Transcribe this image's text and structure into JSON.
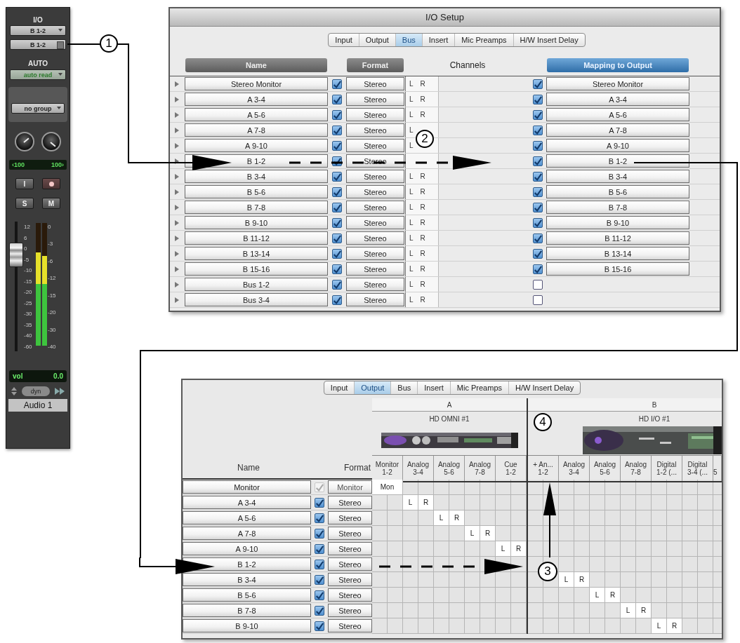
{
  "strip": {
    "io_label": "I/O",
    "input": "B 1-2",
    "output": "B 1-2",
    "auto_label": "AUTO",
    "automation": "auto read",
    "group": "no group",
    "pan": [
      "‹100",
      "100›"
    ],
    "buttons": [
      {
        "kind": "input",
        "label": "I"
      },
      {
        "kind": "record"
      },
      {
        "kind": "solo",
        "label": "S"
      },
      {
        "kind": "mute",
        "label": "M"
      }
    ],
    "fader": {
      "level": 0.8,
      "scale": [
        "12",
        "6",
        "0",
        "-5",
        "-10",
        "-15",
        "-20",
        "-25",
        "-30",
        "-35",
        "-40",
        "-60"
      ]
    },
    "meters": [
      {
        "level": 0.76
      },
      {
        "level": 0.73
      }
    ],
    "meter_scale": [
      "0",
      "-3",
      "-6",
      "-12",
      "-15",
      "-20",
      "-30",
      "-40"
    ],
    "volume": {
      "label": "vol",
      "value": "0.0"
    },
    "dyn": "dyn",
    "name": "Audio 1"
  },
  "io_setup": {
    "title": "I/O Setup",
    "tabs": [
      {
        "label": "Input",
        "selected": false
      },
      {
        "label": "Output",
        "selected": false
      },
      {
        "label": "Bus",
        "selected": true
      },
      {
        "label": "Insert",
        "selected": false
      },
      {
        "label": "Mic Preamps",
        "selected": false
      },
      {
        "label": "H/W Insert Delay",
        "selected": false
      }
    ],
    "headers": [
      {
        "kind": "button",
        "label": "Name",
        "selected": false
      },
      {
        "kind": "button",
        "label": "Format",
        "selected": false
      },
      {
        "kind": "label",
        "label": "Channels"
      },
      {
        "kind": "button",
        "label": "Mapping to Output",
        "selected": true
      }
    ],
    "rows": [
      {
        "name": "Stereo Monitor",
        "checked": true,
        "format": "Stereo",
        "channels": [
          "L",
          "R"
        ],
        "mapped": true,
        "mapping": "Stereo Monitor"
      },
      {
        "name": "A 3-4",
        "checked": true,
        "format": "Stereo",
        "channels": [
          "L",
          "R"
        ],
        "mapped": true,
        "mapping": "A 3-4"
      },
      {
        "name": "A 5-6",
        "checked": true,
        "format": "Stereo",
        "channels": [
          "L",
          "R"
        ],
        "mapped": true,
        "mapping": "A 5-6"
      },
      {
        "name": "A 7-8",
        "checked": true,
        "format": "Stereo",
        "channels": [
          "L"
        ],
        "mapped": true,
        "mapping": "A 7-8"
      },
      {
        "name": "A 9-10",
        "checked": true,
        "format": "Stereo",
        "channels": [
          "L"
        ],
        "mapped": true,
        "mapping": "A 9-10"
      },
      {
        "name": "B 1-2",
        "checked": true,
        "format": "Stereo",
        "mapped": true,
        "mapping": "B 1-2"
      },
      {
        "name": "B 3-4",
        "checked": true,
        "format": "Stereo",
        "channels": [
          "L",
          "R"
        ],
        "mapped": true,
        "mapping": "B 3-4"
      },
      {
        "name": "B 5-6",
        "checked": true,
        "format": "Stereo",
        "channels": [
          "L",
          "R"
        ],
        "mapped": true,
        "mapping": "B 5-6"
      },
      {
        "name": "B 7-8",
        "checked": true,
        "format": "Stereo",
        "channels": [
          "L",
          "R"
        ],
        "mapped": true,
        "mapping": "B 7-8"
      },
      {
        "name": "B 9-10",
        "checked": true,
        "format": "Stereo",
        "channels": [
          "L",
          "R"
        ],
        "mapped": true,
        "mapping": "B 9-10"
      },
      {
        "name": "B 11-12",
        "checked": true,
        "format": "Stereo",
        "channels": [
          "L",
          "R"
        ],
        "mapped": true,
        "mapping": "B 11-12"
      },
      {
        "name": "B 13-14",
        "checked": true,
        "format": "Stereo",
        "channels": [
          "L",
          "R"
        ],
        "mapped": true,
        "mapping": "B 13-14"
      },
      {
        "name": "B 15-16",
        "checked": true,
        "format": "Stereo",
        "channels": [
          "L",
          "R"
        ],
        "mapped": true,
        "mapping": "B 15-16"
      },
      {
        "name": "Bus 1-2",
        "checked": true,
        "format": "Stereo",
        "channels": [
          "L",
          "R"
        ],
        "mapped": false
      },
      {
        "name": "Bus 3-4",
        "checked": true,
        "format": "Stereo",
        "channels": [
          "L",
          "R"
        ],
        "mapped": false
      }
    ]
  },
  "output_setup": {
    "tabs": [
      {
        "label": "Input",
        "selected": false
      },
      {
        "label": "Output",
        "selected": true
      },
      {
        "label": "Bus",
        "selected": false
      },
      {
        "label": "Insert",
        "selected": false
      },
      {
        "label": "Mic Preamps",
        "selected": false
      },
      {
        "label": "H/W Insert Delay",
        "selected": false
      }
    ],
    "headers": {
      "name": "Name",
      "format": "Format"
    },
    "groups": [
      {
        "label": "A",
        "device": "HD OMNI #1",
        "image": {
          "kind": "picture"
        },
        "columns": [
          {
            "line1": "Monitor",
            "line2": "1-2"
          },
          {
            "line1": "Analog",
            "line2": "3-4"
          },
          {
            "line1": "Analog",
            "line2": "5-6"
          },
          {
            "line1": "Analog",
            "line2": "7-8"
          },
          {
            "line1": "Cue",
            "line2": "1-2"
          }
        ]
      },
      {
        "label": "B",
        "device": "HD I/O #1",
        "image": {
          "kind": "picture"
        },
        "columns": [
          {
            "line1": "+ An...",
            "line2": "1-2"
          },
          {
            "line1": "Analog",
            "line2": "3-4"
          },
          {
            "line1": "Analog",
            "line2": "5-6"
          },
          {
            "line1": "Analog",
            "line2": "7-8"
          },
          {
            "line1": "Digital",
            "line2": "1-2 (..."
          },
          {
            "line1": "Digital",
            "line2": "3-4 (..."
          },
          {
            "line2": "5",
            "kind": "partial"
          }
        ]
      }
    ],
    "rows": [
      {
        "name": "Monitor",
        "checked": true,
        "disabled": true,
        "format": "Monitor",
        "patch": [
          {
            "kind": "mono",
            "text": "Mon"
          }
        ]
      },
      {
        "name": "A 3-4",
        "checked": true,
        "disabled": false,
        "format": "Stereo",
        "patch": [
          {
            "kind": "empty"
          },
          {
            "kind": "pair",
            "left": "L",
            "right": "R"
          }
        ]
      },
      {
        "name": "A 5-6",
        "checked": true,
        "disabled": false,
        "format": "Stereo",
        "patch": [
          {
            "kind": "empty"
          },
          {
            "kind": "empty"
          },
          {
            "kind": "pair",
            "left": "L",
            "right": "R"
          }
        ]
      },
      {
        "name": "A 7-8",
        "checked": true,
        "disabled": false,
        "format": "Stereo",
        "patch": [
          {
            "kind": "empty"
          },
          {
            "kind": "empty"
          },
          {
            "kind": "empty"
          },
          {
            "kind": "pair",
            "left": "L",
            "right": "R"
          }
        ]
      },
      {
        "name": "A 9-10",
        "checked": true,
        "disabled": false,
        "format": "Stereo",
        "patch": [
          {
            "kind": "empty"
          },
          {
            "kind": "empty"
          },
          {
            "kind": "empty"
          },
          {
            "kind": "empty"
          },
          {
            "kind": "pair",
            "left": "L",
            "right": "R"
          }
        ]
      },
      {
        "name": "B 1-2",
        "checked": true,
        "disabled": false,
        "format": "Stereo"
      },
      {
        "name": "B 3-4",
        "checked": true,
        "disabled": false,
        "format": "Stereo",
        "patch": [
          {
            "kind": "empty"
          },
          {
            "kind": "empty"
          },
          {
            "kind": "empty"
          },
          {
            "kind": "empty"
          },
          {
            "kind": "empty"
          },
          {
            "kind": "empty"
          },
          {
            "kind": "pair",
            "left": "L",
            "right": "R"
          }
        ]
      },
      {
        "name": "B 5-6",
        "checked": true,
        "disabled": false,
        "format": "Stereo",
        "patch": [
          {
            "kind": "empty"
          },
          {
            "kind": "empty"
          },
          {
            "kind": "empty"
          },
          {
            "kind": "empty"
          },
          {
            "kind": "empty"
          },
          {
            "kind": "empty"
          },
          {
            "kind": "empty"
          },
          {
            "kind": "pair",
            "left": "L",
            "right": "R"
          }
        ]
      },
      {
        "name": "B 7-8",
        "checked": true,
        "disabled": false,
        "format": "Stereo",
        "patch": [
          {
            "kind": "empty"
          },
          {
            "kind": "empty"
          },
          {
            "kind": "empty"
          },
          {
            "kind": "empty"
          },
          {
            "kind": "empty"
          },
          {
            "kind": "empty"
          },
          {
            "kind": "empty"
          },
          {
            "kind": "empty"
          },
          {
            "kind": "pair",
            "left": "L",
            "right": "R"
          }
        ]
      },
      {
        "name": "B 9-10",
        "checked": true,
        "disabled": false,
        "format": "Stereo",
        "patch": [
          {
            "kind": "empty"
          },
          {
            "kind": "empty"
          },
          {
            "kind": "empty"
          },
          {
            "kind": "empty"
          },
          {
            "kind": "empty"
          },
          {
            "kind": "empty"
          },
          {
            "kind": "empty"
          },
          {
            "kind": "empty"
          },
          {
            "kind": "empty"
          },
          {
            "kind": "pair",
            "left": "L",
            "right": "R"
          }
        ]
      }
    ]
  },
  "callouts": [
    {
      "number": "1"
    },
    {
      "number": "2"
    },
    {
      "number": "3"
    },
    {
      "number": "4"
    }
  ]
}
